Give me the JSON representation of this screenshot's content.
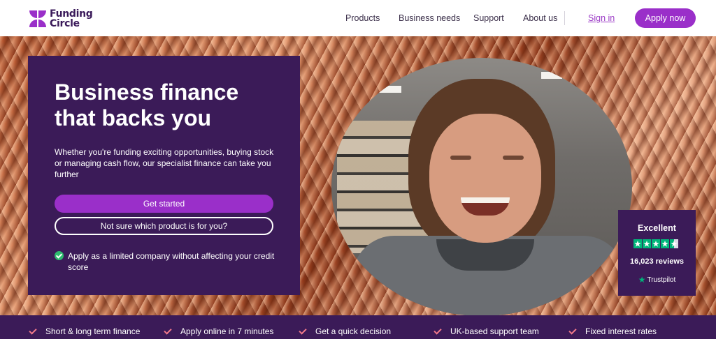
{
  "brand": {
    "logo_line1": "Funding",
    "logo_line2": "Circle",
    "accent_color": "#9a2fc9",
    "dark_color": "#3b1b58",
    "logo_icon": "funding-circle-logo-icon"
  },
  "nav": {
    "items": [
      "Products",
      "Business needs",
      "Support",
      "About us"
    ],
    "sign_in": "Sign in",
    "apply_now": "Apply now"
  },
  "hero": {
    "title": "Business finance that backs you",
    "description": "Whether you're funding exciting opportunities, buying stock or managing cash flow, our specialist finance can take you further",
    "primary_cta": "Get started",
    "secondary_cta": "Not sure which product is for you?",
    "check_text": "Apply as a limited company without affecting your credit score"
  },
  "trustpilot": {
    "rating_text": "Excellent",
    "stars": 4.5,
    "reviews": "16,023 reviews",
    "brand": "Trustpilot",
    "star_color": "#00b67a"
  },
  "features": [
    "Short & long term finance",
    "Apply online in 7 minutes",
    "Get a quick decision",
    "UK-based support team",
    "Fixed interest rates"
  ]
}
